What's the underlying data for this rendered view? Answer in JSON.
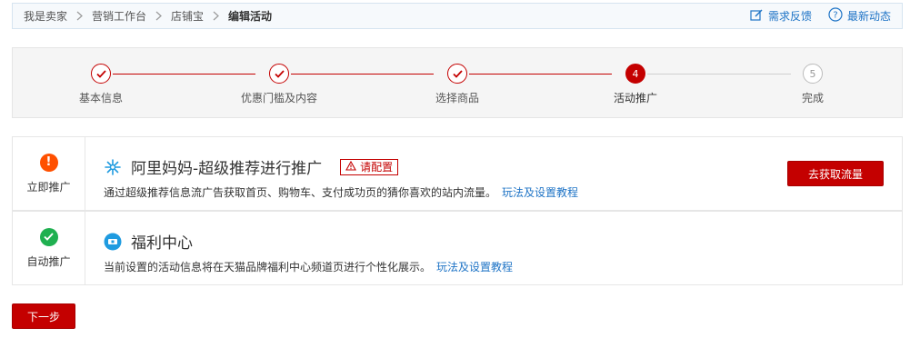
{
  "breadcrumb": {
    "items": [
      "我是卖家",
      "营销工作台",
      "店铺宝",
      "编辑活动"
    ]
  },
  "top_actions": {
    "feedback_label": "需求反馈",
    "feedback_icon": "edit-icon",
    "news_label": "最新动态",
    "news_icon": "question-circle-icon"
  },
  "steps": {
    "items": [
      {
        "number": "1",
        "label": "基本信息",
        "state": "done"
      },
      {
        "number": "2",
        "label": "优惠门槛及内容",
        "state": "done"
      },
      {
        "number": "3",
        "label": "选择商品",
        "state": "done"
      },
      {
        "number": "4",
        "label": "活动推广",
        "state": "active"
      },
      {
        "number": "5",
        "label": "完成",
        "state": "todo"
      }
    ]
  },
  "promotions": [
    {
      "status_label": "立即推广",
      "status_icon": "exclamation-icon",
      "status_symbol": "!",
      "title_icon": "sparkle-icon",
      "title": "阿里妈妈-超级推荐进行推广",
      "tag_label": "请配置",
      "description": "通过超级推荐信息流广告获取首页、购物车、支付成功页的猜你喜欢的站内流量。",
      "link_label": "玩法及设置教程",
      "action_label": "去获取流量"
    },
    {
      "status_label": "自动推广",
      "status_icon": "check-icon",
      "title_icon": "ticket-icon",
      "title": "福利中心",
      "description": "当前设置的活动信息将在天猫品牌福利中心频道页进行个性化展示。",
      "link_label": "玩法及设置教程"
    }
  ],
  "footer": {
    "next_label": "下一步"
  },
  "colors": {
    "primary": "#c40000",
    "link": "#1f74c6",
    "warning": "#ff5000",
    "success": "#1fb050"
  }
}
